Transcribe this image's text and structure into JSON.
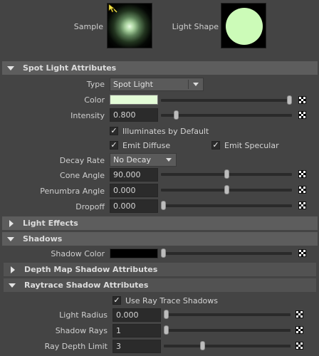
{
  "swatches": {
    "sample_label": "Sample",
    "light_shape_label": "Light Shape"
  },
  "spot_light": {
    "header": "Spot Light Attributes",
    "type_label": "Type",
    "type_value": "Spot Light",
    "color_label": "Color",
    "color_value": "#e3fcd7",
    "intensity_label": "Intensity",
    "intensity_value": "0.800",
    "illuminates_label": "Illuminates by Default",
    "illuminates_checked": true,
    "emit_diffuse_label": "Emit Diffuse",
    "emit_diffuse_checked": true,
    "emit_specular_label": "Emit Specular",
    "emit_specular_checked": true,
    "decay_label": "Decay Rate",
    "decay_value": "No Decay",
    "cone_label": "Cone Angle",
    "cone_value": "90.000",
    "penumbra_label": "Penumbra Angle",
    "penumbra_value": "0.000",
    "dropoff_label": "Dropoff",
    "dropoff_value": "0.000"
  },
  "light_effects": {
    "header": "Light Effects"
  },
  "shadows": {
    "header": "Shadows",
    "shadow_color_label": "Shadow Color",
    "shadow_color_value": "#000000"
  },
  "depth_map": {
    "header": "Depth Map Shadow Attributes"
  },
  "raytrace": {
    "header": "Raytrace Shadow Attributes",
    "use_raytrace_label": "Use Ray Trace Shadows",
    "use_raytrace_checked": true,
    "light_radius_label": "Light Radius",
    "light_radius_value": "0.000",
    "shadow_rays_label": "Shadow Rays",
    "shadow_rays_value": "1",
    "ray_depth_label": "Ray Depth Limit",
    "ray_depth_value": "3"
  },
  "slider_levels": {
    "color": 1.0,
    "intensity": 0.1,
    "cone": 0.5,
    "penumbra": 0.5,
    "dropoff": 0.0,
    "shadow_color": 0.0,
    "light_radius": 0.0,
    "shadow_rays": 0.0,
    "ray_depth": 0.3
  }
}
